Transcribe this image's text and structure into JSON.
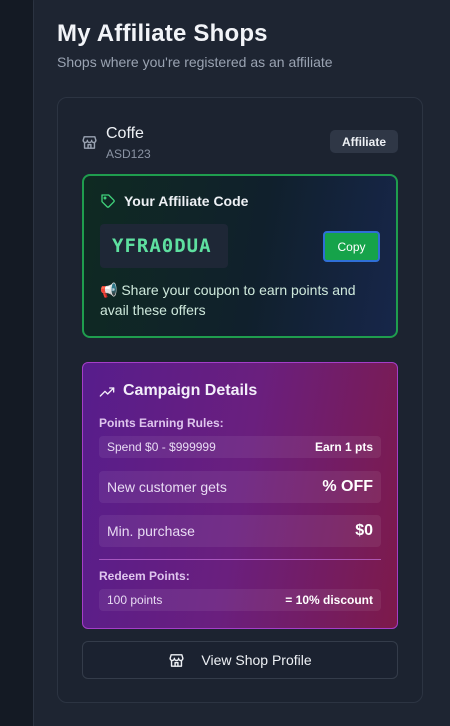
{
  "header": {
    "title": "My Affiliate Shops",
    "subtitle": "Shops where you're registered as an affiliate"
  },
  "shop": {
    "name": "Coffe",
    "code": "ASD123",
    "badge": "Affiliate"
  },
  "affiliate": {
    "title": "Your Affiliate Code",
    "code": "YFRA0DUA",
    "copy_label": "Copy",
    "share_text": "📢 Share your coupon to earn points and avail these offers"
  },
  "campaign": {
    "title": "Campaign Details",
    "earning_label": "Points Earning Rules:",
    "spend_range": "Spend $0 - $999999",
    "earn_points": "Earn 1 pts",
    "new_customer_label": "New customer gets",
    "new_customer_value": "% OFF",
    "min_purchase_label": "Min. purchase",
    "min_purchase_value": "$0",
    "redeem_label": "Redeem Points:",
    "redeem_points": "100 points",
    "redeem_value": "= 10% discount"
  },
  "actions": {
    "view_profile": "View Shop Profile"
  },
  "colors": {
    "accent_green": "#16a34a",
    "code_text": "#5ee0a0",
    "campaign_purple": "#6a1f7e"
  }
}
